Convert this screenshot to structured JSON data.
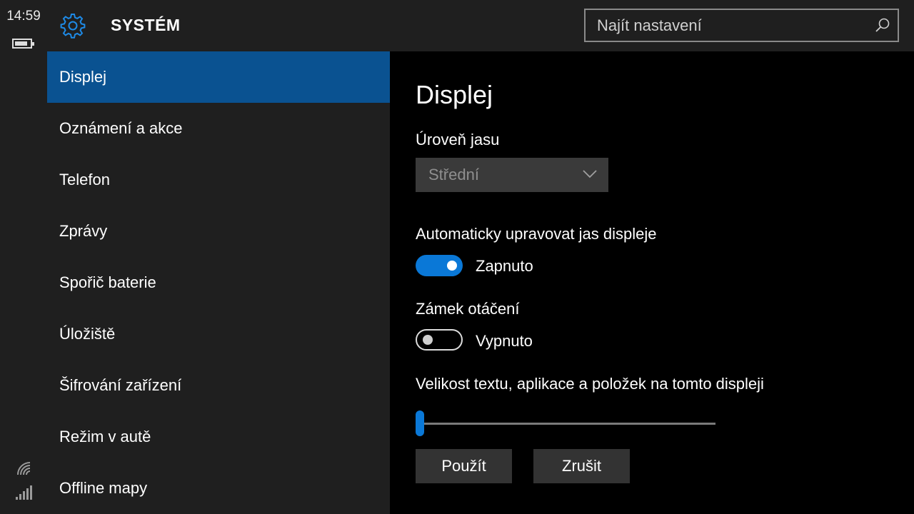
{
  "status": {
    "time": "14:59",
    "battery_level": 0.85
  },
  "header": {
    "title": "SYSTÉM",
    "search_placeholder": "Najít nastavení",
    "icons": [
      "gear-icon",
      "search-icon"
    ]
  },
  "sidebar": {
    "items": [
      {
        "label": "Displej",
        "active": true
      },
      {
        "label": "Oznámení a akce",
        "active": false
      },
      {
        "label": "Telefon",
        "active": false
      },
      {
        "label": "Zprávy",
        "active": false
      },
      {
        "label": "Spořič baterie",
        "active": false
      },
      {
        "label": "Úložiště",
        "active": false
      },
      {
        "label": "Šifrování zařízení",
        "active": false
      },
      {
        "label": "Režim v autě",
        "active": false
      },
      {
        "label": "Offline mapy",
        "active": false
      }
    ]
  },
  "main": {
    "title": "Displej",
    "brightness": {
      "label": "Úroveň jasu",
      "value": "Střední"
    },
    "auto_brightness": {
      "label": "Automaticky upravovat jas displeje",
      "state": "Zapnuto",
      "on": true
    },
    "rotation_lock": {
      "label": "Zámek otáčení",
      "state": "Vypnuto",
      "on": false
    },
    "text_size": {
      "label": "Velikost textu, aplikace a položek na tomto displeji",
      "value_fraction": 0.0
    },
    "apply_label": "Použít",
    "cancel_label": "Zrušit"
  },
  "colors": {
    "accent": "#0a78d7",
    "selected": "#0a5291",
    "panel": "#1f1f1f",
    "background": "#000000"
  }
}
